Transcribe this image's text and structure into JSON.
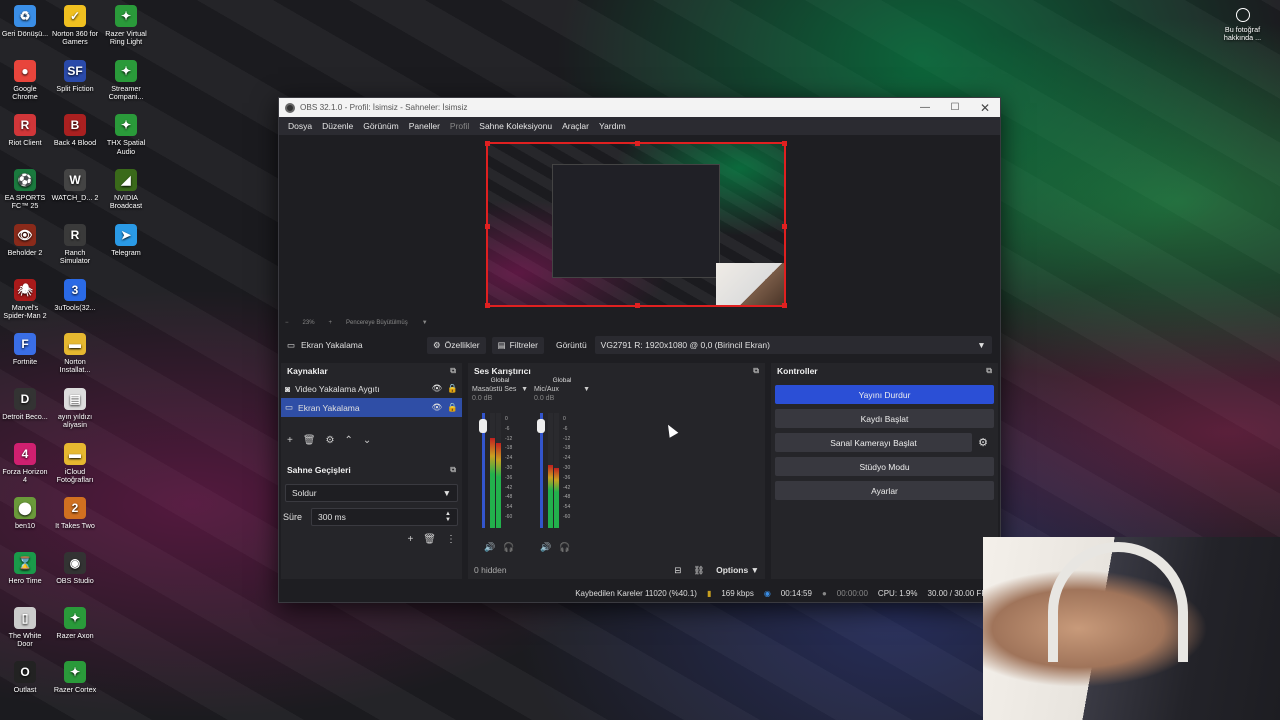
{
  "desktop": {
    "icons_col1": [
      {
        "label": "Geri Dönüşü...",
        "icon": "recycle-bin-icon",
        "color": "#3a8ee6",
        "glyph": "♻"
      },
      {
        "label": "Google Chrome",
        "icon": "chrome-icon",
        "color": "#e8453c",
        "glyph": "●"
      },
      {
        "label": "Riot Client",
        "icon": "riot-icon",
        "color": "#d13639",
        "glyph": "R"
      },
      {
        "label": "EA SPORTS FC™ 25",
        "icon": "ea-fc-icon",
        "color": "#1a7a3e",
        "glyph": "⚽"
      },
      {
        "label": "Beholder 2",
        "icon": "beholder-icon",
        "color": "#8a2a1a",
        "glyph": "👁"
      },
      {
        "label": "Marvel's Spider-Man 2",
        "icon": "spiderman-icon",
        "color": "#aa1a1a",
        "glyph": "🕷"
      },
      {
        "label": "Fortnite",
        "icon": "fortnite-icon",
        "color": "#3a6ee6",
        "glyph": "F"
      },
      {
        "label": "Detroit Beco...",
        "icon": "detroit-icon",
        "color": "#333",
        "glyph": "D"
      },
      {
        "label": "Forza Horizon 4",
        "icon": "forza-icon",
        "color": "#d02070",
        "glyph": "4"
      },
      {
        "label": "ben10",
        "icon": "ben10-icon",
        "color": "#6a9a3a",
        "glyph": "⬤"
      },
      {
        "label": "Hero Time",
        "icon": "hero-time-icon",
        "color": "#1a9a4a",
        "glyph": "⌛"
      },
      {
        "label": "The White Door",
        "icon": "white-door-icon",
        "color": "#ccc",
        "glyph": "▯"
      },
      {
        "label": "Outlast",
        "icon": "outlast-icon",
        "color": "#222",
        "glyph": "O"
      }
    ],
    "icons_col2": [
      {
        "label": "Norton 360 for Gamers",
        "icon": "norton-icon",
        "color": "#f0c020",
        "glyph": "✓"
      },
      {
        "label": "Split Fiction",
        "icon": "split-fiction-icon",
        "color": "#2a4aaa",
        "glyph": "SF"
      },
      {
        "label": "Back 4 Blood",
        "icon": "back4blood-icon",
        "color": "#aa2020",
        "glyph": "B"
      },
      {
        "label": "WATCH_D... 2",
        "icon": "watchdogs-icon",
        "color": "#444",
        "glyph": "W"
      },
      {
        "label": "Ranch Simulator",
        "icon": "ranch-icon",
        "color": "#3a3a3a",
        "glyph": "R"
      },
      {
        "label": "3uTools(32...",
        "icon": "3utools-icon",
        "color": "#2a6ae6",
        "glyph": "3"
      },
      {
        "label": "Norton Installat...",
        "icon": "folder-icon",
        "color": "#e6b830",
        "glyph": "▬"
      },
      {
        "label": "ayın yıldızı aliyasin",
        "icon": "file-icon",
        "color": "#ddd",
        "glyph": "▤"
      },
      {
        "label": "iCloud Fotoğrafları",
        "icon": "folder-icon",
        "color": "#e6b830",
        "glyph": "▬"
      },
      {
        "label": "It Takes Two",
        "icon": "it-takes-two-icon",
        "color": "#d07020",
        "glyph": "2"
      },
      {
        "label": "OBS Studio",
        "icon": "obs-icon",
        "color": "#333",
        "glyph": "◉"
      },
      {
        "label": "Razer Axon",
        "icon": "razer-axon-icon",
        "color": "#2a9a3a",
        "glyph": "✦"
      },
      {
        "label": "Razer Cortex",
        "icon": "razer-cortex-icon",
        "color": "#2a9a3a",
        "glyph": "✦"
      }
    ],
    "icons_col3": [
      {
        "label": "Razer Virtual Ring Light",
        "icon": "razer-icon",
        "color": "#2a9a3a",
        "glyph": "✦"
      },
      {
        "label": "Streamer Compani...",
        "icon": "razer-icon",
        "color": "#2a9a3a",
        "glyph": "✦"
      },
      {
        "label": "THX Spatial Audio",
        "icon": "razer-icon",
        "color": "#2a9a3a",
        "glyph": "✦"
      },
      {
        "label": "NVIDIA Broadcast",
        "icon": "nvidia-icon",
        "color": "#3a6a1a",
        "glyph": "◢"
      },
      {
        "label": "Telegram",
        "icon": "telegram-icon",
        "color": "#2a9ae6",
        "glyph": "➤"
      }
    ],
    "bu_fotograf": "Bu fotoğraf hakkında ..."
  },
  "obs": {
    "title": "OBS 32.1.0 - Profil: İsimsiz - Sahneler: İsimsiz",
    "menu": [
      "Dosya",
      "Düzenle",
      "Görünüm",
      "Paneller",
      "Profil",
      "Sahne Koleksiyonu",
      "Araçlar",
      "Yardım"
    ],
    "preview_zoom": "23%",
    "preview_fit": "Pencereye Büyütülmüş",
    "source_toolbar": {
      "current_source": "Ekran Yakalama",
      "properties": "Özellikler",
      "filters": "Filtreler",
      "display_label": "Görüntü",
      "display_value": "VG2791 R: 1920x1080 @ 0,0 (Birincil Ekran)"
    },
    "sources": {
      "title": "Kaynaklar",
      "items": [
        {
          "label": "Video Yakalama Aygıtı",
          "selected": false
        },
        {
          "label": "Ekran Yakalama",
          "selected": true
        }
      ]
    },
    "transitions": {
      "title": "Sahne Geçişleri",
      "type": "Soldur",
      "duration_label": "Süre",
      "duration_value": "300 ms"
    },
    "mixer": {
      "title": "Ses Karıştırıcı",
      "channels": [
        {
          "global": "Global",
          "name": "Masaüstü Ses",
          "db": "0.0 dB",
          "level": 0.78
        },
        {
          "global": "Global",
          "name": "Mic/Aux",
          "db": "0.0 dB",
          "level": 0.55
        }
      ],
      "ticks": [
        "0",
        "-6",
        "-12",
        "-18",
        "-24",
        "-30",
        "-36",
        "-42",
        "-48",
        "-54",
        "-60"
      ],
      "hidden": "0 hidden",
      "options": "Options"
    },
    "controls": {
      "title": "Kontroller",
      "buttons": [
        "Yayını Durdur",
        "Kaydı Başlat",
        "Sanal Kamerayı Başlat",
        "Stüdyo Modu",
        "Ayarlar"
      ]
    },
    "status": {
      "dropped": "Kaybedilen Kareler 11020 (%40.1)",
      "kbps": "169 kbps",
      "stream_time": "00:14:59",
      "rec_time": "00:00:00",
      "cpu": "CPU: 1.9%",
      "fps": "30.00 / 30.00 FPS"
    }
  }
}
